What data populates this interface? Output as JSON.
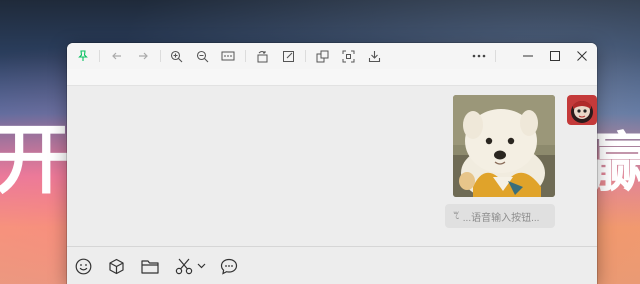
{
  "background": {
    "text_left": "开始",
    "text_right": "赢"
  },
  "window": {
    "titlebar_icons": [
      "pin-icon",
      "back-arrow-icon",
      "forward-arrow-icon",
      "zoom-in-icon",
      "zoom-out-icon",
      "fit-width-icon",
      "rotate-icon",
      "edit-icon",
      "extract-icon",
      "screenshot-icon",
      "download-icon",
      "more-icon",
      "minimize-icon",
      "maximize-icon",
      "close-icon"
    ],
    "pin_color": "#07c160"
  },
  "chat": {
    "voice_input_text": "...语音输入按钮..."
  },
  "toolbar": {
    "icons": [
      "emoji-icon",
      "package-icon",
      "folder-icon",
      "scissors-icon",
      "chevron-down-icon",
      "chat-bubble-icon"
    ]
  }
}
